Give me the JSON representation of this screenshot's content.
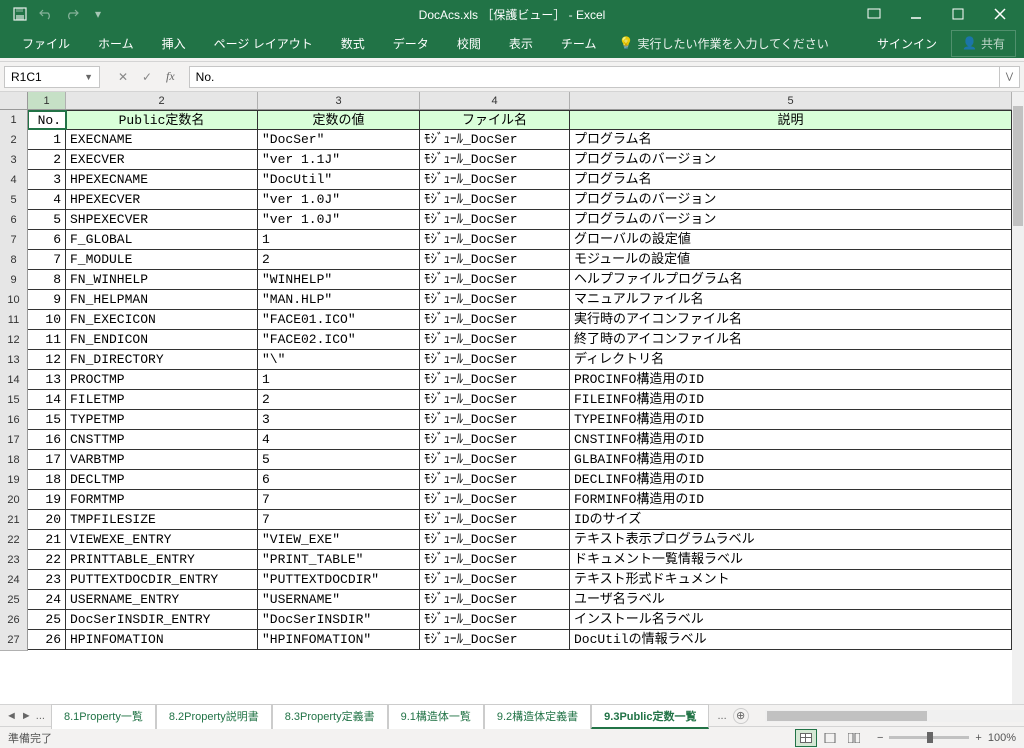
{
  "title": "DocAcs.xls ［保護ビュー］ - Excel",
  "qat": {
    "save": "保存",
    "undo": "元に戻す",
    "redo": "やり直し"
  },
  "ribbon": {
    "tabs": [
      "ファイル",
      "ホーム",
      "挿入",
      "ページ レイアウト",
      "数式",
      "データ",
      "校閲",
      "表示",
      "チーム"
    ],
    "tellme": "実行したい作業を入力してください",
    "signin": "サインイン",
    "share": "共有"
  },
  "namebox": "R1C1",
  "formula": "No.",
  "colHeaders": [
    "1",
    "2",
    "3",
    "4",
    "5"
  ],
  "tableHeaders": [
    "No.",
    "Public定数名",
    "定数の値",
    "ファイル名",
    "説明"
  ],
  "rows": [
    {
      "n": 1,
      "name": "EXECNAME",
      "val": "\"DocSer\"",
      "file": "ﾓｼﾞｭｰﾙ_DocSer",
      "desc": "プログラム名"
    },
    {
      "n": 2,
      "name": "EXECVER",
      "val": "\"ver 1.1J\"",
      "file": "ﾓｼﾞｭｰﾙ_DocSer",
      "desc": "プログラムのバージョン"
    },
    {
      "n": 3,
      "name": "HPEXECNAME",
      "val": "\"DocUtil\"",
      "file": "ﾓｼﾞｭｰﾙ_DocSer",
      "desc": "プログラム名"
    },
    {
      "n": 4,
      "name": "HPEXECVER",
      "val": "\"ver 1.0J\"",
      "file": "ﾓｼﾞｭｰﾙ_DocSer",
      "desc": "プログラムのバージョン"
    },
    {
      "n": 5,
      "name": "SHPEXECVER",
      "val": "\"ver 1.0J\"",
      "file": "ﾓｼﾞｭｰﾙ_DocSer",
      "desc": "プログラムのバージョン"
    },
    {
      "n": 6,
      "name": "F_GLOBAL",
      "val": "1",
      "file": "ﾓｼﾞｭｰﾙ_DocSer",
      "desc": "グローバルの設定値"
    },
    {
      "n": 7,
      "name": "F_MODULE",
      "val": "2",
      "file": "ﾓｼﾞｭｰﾙ_DocSer",
      "desc": "モジュールの設定値"
    },
    {
      "n": 8,
      "name": "FN_WINHELP",
      "val": "\"WINHELP\"",
      "file": "ﾓｼﾞｭｰﾙ_DocSer",
      "desc": "ヘルプファイルプログラム名"
    },
    {
      "n": 9,
      "name": "FN_HELPMAN",
      "val": "\"MAN.HLP\"",
      "file": "ﾓｼﾞｭｰﾙ_DocSer",
      "desc": "マニュアルファイル名"
    },
    {
      "n": 10,
      "name": "FN_EXECICON",
      "val": "\"FACE01.ICO\"",
      "file": "ﾓｼﾞｭｰﾙ_DocSer",
      "desc": "実行時のアイコンファイル名"
    },
    {
      "n": 11,
      "name": "FN_ENDICON",
      "val": "\"FACE02.ICO\"",
      "file": "ﾓｼﾞｭｰﾙ_DocSer",
      "desc": "終了時のアイコンファイル名"
    },
    {
      "n": 12,
      "name": "FN_DIRECTORY",
      "val": "\"\\\"",
      "file": "ﾓｼﾞｭｰﾙ_DocSer",
      "desc": "ディレクトリ名"
    },
    {
      "n": 13,
      "name": "PROCTMP",
      "val": "1",
      "file": "ﾓｼﾞｭｰﾙ_DocSer",
      "desc": "PROCINFO構造用のID"
    },
    {
      "n": 14,
      "name": "FILETMP",
      "val": "2",
      "file": "ﾓｼﾞｭｰﾙ_DocSer",
      "desc": "FILEINFO構造用のID"
    },
    {
      "n": 15,
      "name": "TYPETMP",
      "val": "3",
      "file": "ﾓｼﾞｭｰﾙ_DocSer",
      "desc": "TYPEINFO構造用のID"
    },
    {
      "n": 16,
      "name": "CNSTTMP",
      "val": "4",
      "file": "ﾓｼﾞｭｰﾙ_DocSer",
      "desc": "CNSTINFO構造用のID"
    },
    {
      "n": 17,
      "name": "VARBTMP",
      "val": "5",
      "file": "ﾓｼﾞｭｰﾙ_DocSer",
      "desc": "GLBAINFO構造用のID"
    },
    {
      "n": 18,
      "name": "DECLTMP",
      "val": "6",
      "file": "ﾓｼﾞｭｰﾙ_DocSer",
      "desc": "DECLINFO構造用のID"
    },
    {
      "n": 19,
      "name": "FORMTMP",
      "val": "7",
      "file": "ﾓｼﾞｭｰﾙ_DocSer",
      "desc": "FORMINFO構造用のID"
    },
    {
      "n": 20,
      "name": "TMPFILESIZE",
      "val": "7",
      "file": "ﾓｼﾞｭｰﾙ_DocSer",
      "desc": "IDのサイズ"
    },
    {
      "n": 21,
      "name": "VIEWEXE_ENTRY",
      "val": "\"VIEW_EXE\"",
      "file": "ﾓｼﾞｭｰﾙ_DocSer",
      "desc": "テキスト表示プログラムラベル"
    },
    {
      "n": 22,
      "name": "PRINTTABLE_ENTRY",
      "val": "\"PRINT_TABLE\"",
      "file": "ﾓｼﾞｭｰﾙ_DocSer",
      "desc": "ドキュメント一覧情報ラベル"
    },
    {
      "n": 23,
      "name": "PUTTEXTDOCDIR_ENTRY",
      "val": "\"PUTTEXTDOCDIR\"",
      "file": "ﾓｼﾞｭｰﾙ_DocSer",
      "desc": "テキスト形式ドキュメント"
    },
    {
      "n": 24,
      "name": "USERNAME_ENTRY",
      "val": "\"USERNAME\"",
      "file": "ﾓｼﾞｭｰﾙ_DocSer",
      "desc": "ユーザ名ラベル"
    },
    {
      "n": 25,
      "name": "DocSerINSDIR_ENTRY",
      "val": "\"DocSerINSDIR\"",
      "file": "ﾓｼﾞｭｰﾙ_DocSer",
      "desc": "インストール名ラベル"
    },
    {
      "n": 26,
      "name": "HPINFOMATION",
      "val": "\"HPINFOMATION\"",
      "file": "ﾓｼﾞｭｰﾙ_DocSer",
      "desc": "DocUtilの情報ラベル"
    }
  ],
  "sheetTabs": [
    "8.1Property一覧",
    "8.2Property説明書",
    "8.3Property定義書",
    "9.1構造体一覧",
    "9.2構造体定義書",
    "9.3Public定数一覧"
  ],
  "activeTab": 5,
  "status": {
    "ready": "準備完了",
    "zoom": "100%"
  },
  "navEllipsis": "...",
  "addSheet": "+"
}
